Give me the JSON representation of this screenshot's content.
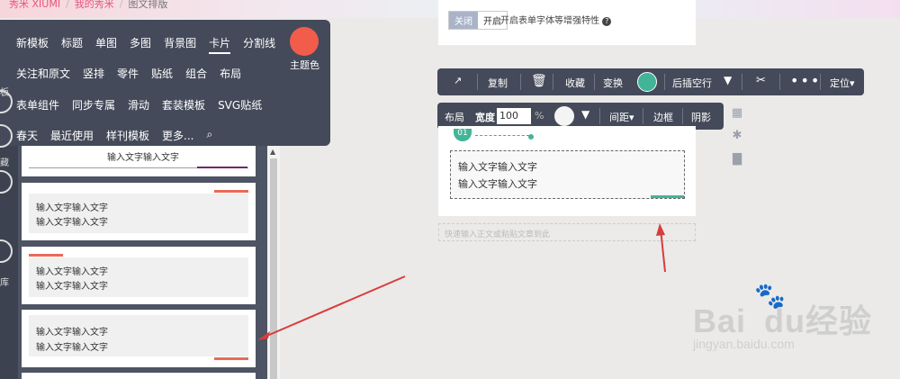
{
  "breadcrumb": {
    "home": "秀米 XIUMI",
    "sep": "/",
    "mine": "我的秀米",
    "current": "图文排版"
  },
  "nav": {
    "row1": [
      "新模板",
      "标题",
      "单图",
      "多图",
      "背景图",
      "卡片",
      "分割线"
    ],
    "row2": [
      "关注和原文",
      "竖排",
      "零件",
      "贴纸",
      "组合",
      "布局"
    ],
    "row3": [
      "表单组件",
      "同步专属",
      "滑动",
      "套装模板",
      "SVG贴纸"
    ],
    "row4": [
      "春天",
      "最近使用",
      "样刊模板",
      "更多..."
    ],
    "theme_label": "主题色",
    "theme_color": "#f25c4b",
    "strip_labels": [
      "板",
      "藏",
      "库"
    ]
  },
  "cards": {
    "top_partial": "输入文字输入文字",
    "items": [
      {
        "line1": "输入文字输入文字",
        "line2": "输入文字输入文字"
      },
      {
        "line1": "输入文字输入文字",
        "line2": "输入文字输入文字"
      },
      {
        "line1": "输入文字输入文字",
        "line2": "输入文字输入文字"
      }
    ]
  },
  "editor": {
    "toggle_off": "关闭",
    "toggle_on": "开启",
    "toggle_hint": "开启表单字体等增强特性",
    "toolbar1": {
      "copy": "复制",
      "collect": "收藏",
      "transform": "变换",
      "insert_after": "后插空行",
      "locate": "定位▾"
    },
    "toolbar2": {
      "layout": "布局",
      "width_label": "宽度",
      "width_value": "100",
      "percent": "%",
      "spacing": "间距▾",
      "border": "边框",
      "shadow": "阴影"
    },
    "step_number": "01",
    "box_line1": "输入文字输入文字",
    "box_line2": "输入文字输入文字",
    "quick_input": "快速输入正文或粘贴文章到此"
  },
  "colors": {
    "accent_green": "#43b497",
    "accent_red": "#e96a55",
    "panel": "#444a59",
    "arrow": "#d93c3c"
  },
  "watermark": {
    "big": "Bai",
    "big2": "du",
    "big3": "经验",
    "small": "jingyan.baidu.com"
  }
}
